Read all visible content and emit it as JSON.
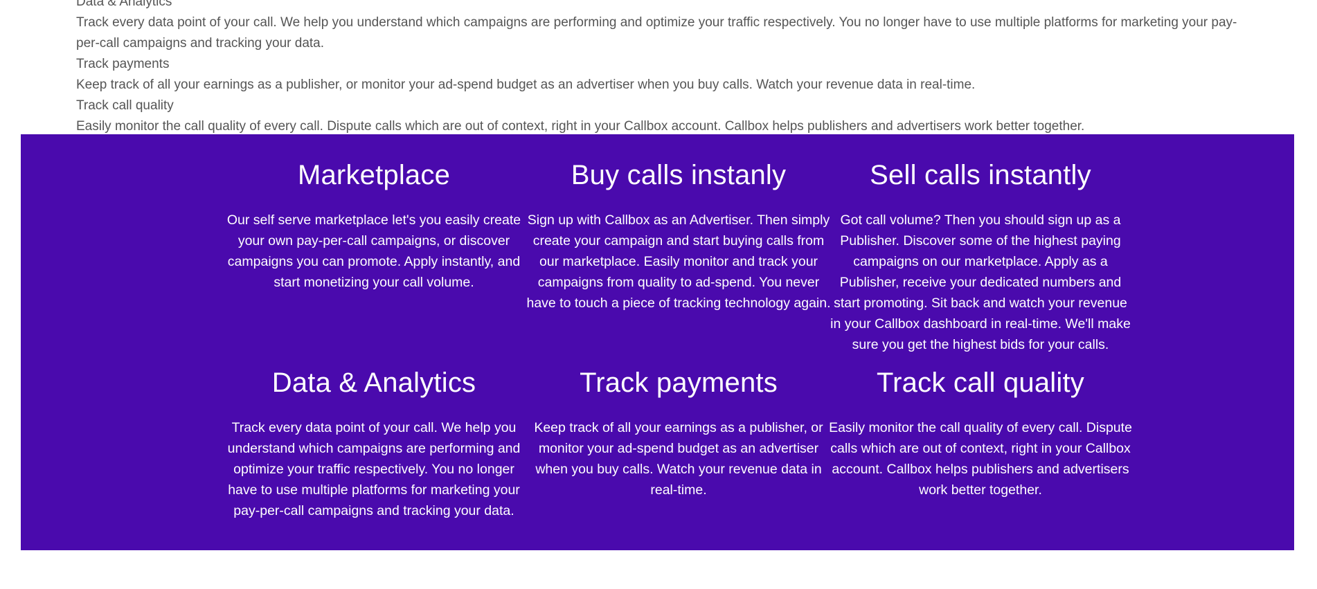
{
  "top_list": [
    "Data & Analytics",
    "Track every data point of your call. We help you understand which campaigns are performing and optimize your traffic respectively. You no longer have to use multiple platforms for marketing your pay-per-call campaigns and tracking your data.",
    "Track payments",
    "Keep track of all your earnings as a publisher, or monitor your ad-spend budget as an advertiser when you buy calls. Watch your revenue data in real-time.",
    "Track call quality",
    "Easily monitor the call quality of every call. Dispute calls which are out of context, right in your Callbox account. Callbox helps publishers and advertisers work better together."
  ],
  "band": {
    "color": "#4a0aad",
    "features": [
      {
        "title": "Marketplace",
        "body": "Our self serve marketplace let's you easily create your own pay-per-call campaigns, or discover campaigns you can promote. Apply instantly, and start monetizing your call volume."
      },
      {
        "title": "Buy calls instanly",
        "body": "Sign up with Callbox as an Advertiser. Then simply create your campaign and start buying calls from our marketplace. Easily monitor and track your campaigns from quality to ad-spend. You never have to touch a piece of tracking technology again."
      },
      {
        "title": "Sell calls instantly",
        "body": "Got call volume? Then you should sign up as a Publisher. Discover some of the highest paying campaigns on our marketplace. Apply as a Publisher, receive your dedicated numbers and start promoting. Sit back and watch your revenue in your Callbox dashboard in real-time. We'll make sure you get the highest bids for your calls."
      },
      {
        "title": "Data & Analytics",
        "body": "Track every data point of your call. We help you understand which campaigns are performing and optimize your traffic respectively. You no longer have to use multiple platforms for marketing your pay-per-call campaigns and tracking your data."
      },
      {
        "title": "Track payments",
        "body": "Keep track of all your earnings as a publisher, or monitor your ad-spend budget as an advertiser when you buy calls. Watch your revenue data in real-time."
      },
      {
        "title": "Track call quality",
        "body": "Easily monitor the call quality of every call. Dispute calls which are out of context, right in your Callbox account. Callbox helps publishers and advertisers work better together."
      }
    ]
  }
}
